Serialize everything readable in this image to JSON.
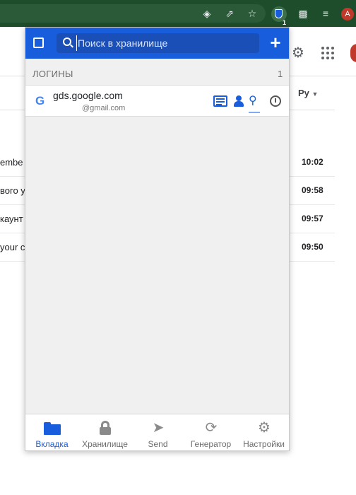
{
  "browser": {
    "extension_badge": "1",
    "profile_initial": "A"
  },
  "background_page": {
    "language_label": "Ру",
    "rows": [
      {
        "snippet": "embe",
        "time": "10:02"
      },
      {
        "snippet": "вого у",
        "time": "09:58"
      },
      {
        "snippet": "каунт",
        "time": "09:57"
      },
      {
        "snippet": "your c",
        "time": "09:50"
      }
    ]
  },
  "popup": {
    "search": {
      "placeholder": "Поиск в хранилище",
      "value": ""
    },
    "section": {
      "title": "ЛОГИНЫ",
      "count": "1"
    },
    "login": {
      "logo": "G",
      "name": "gds.google.com",
      "username": "@gmail.com"
    },
    "tabs": [
      {
        "label": "Вкладка",
        "icon": "folder-icon",
        "active": true
      },
      {
        "label": "Хранилище",
        "icon": "lock-icon",
        "active": false
      },
      {
        "label": "Send",
        "icon": "send-icon",
        "active": false
      },
      {
        "label": "Генератор",
        "icon": "refresh-icon",
        "active": false
      },
      {
        "label": "Настройки",
        "icon": "gears-icon",
        "active": false
      }
    ]
  },
  "colors": {
    "brand": "#175ddc",
    "browser_toolbar": "#1e4d2b"
  }
}
